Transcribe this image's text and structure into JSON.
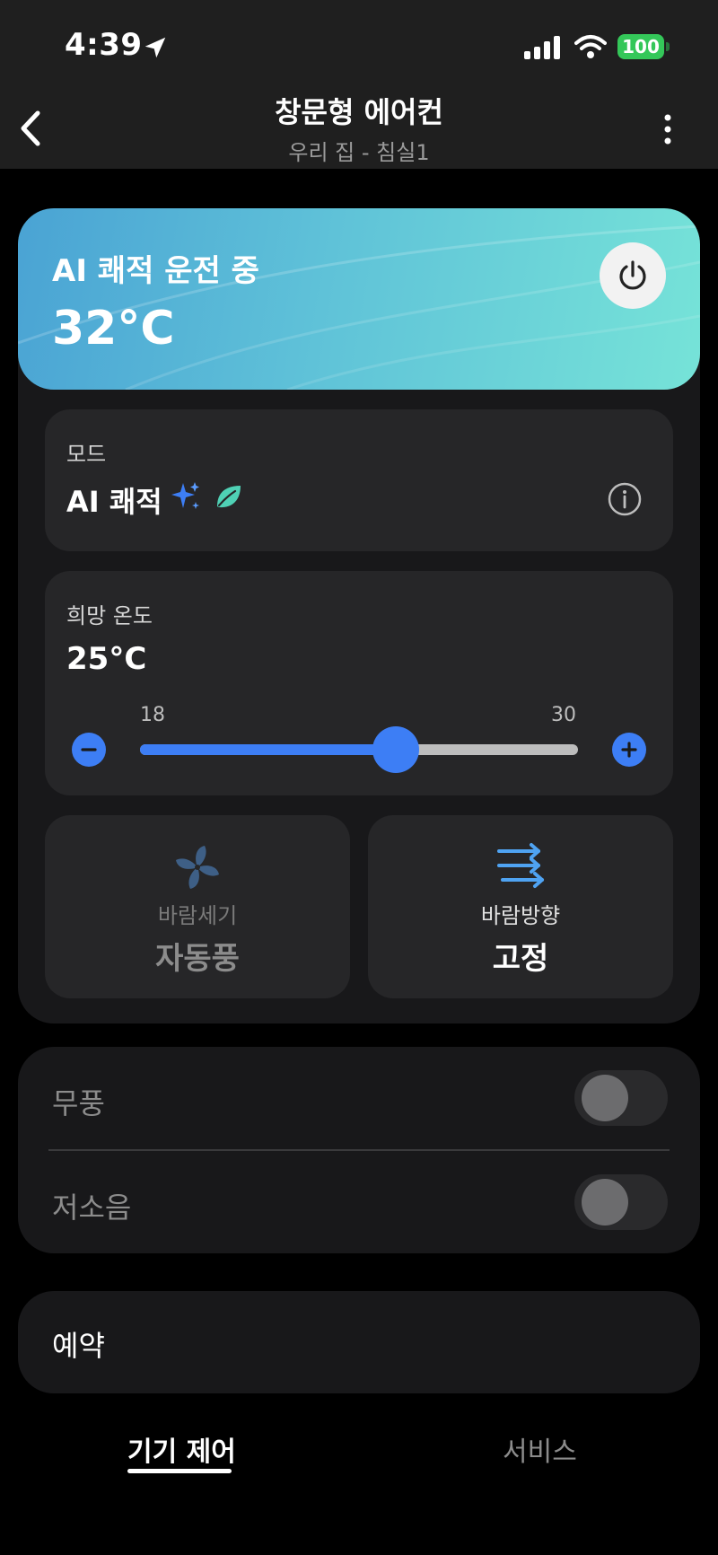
{
  "status_bar": {
    "time": "4:39",
    "battery": "100"
  },
  "header": {
    "title": "창문형 에어컨",
    "subtitle": "우리 집 - 침실1"
  },
  "banner": {
    "status": "AI 쾌적 운전 중",
    "current_temp": "32°C"
  },
  "mode": {
    "label": "모드",
    "value": "AI 쾌적",
    "icons": [
      "sparkle-icon",
      "leaf-icon",
      "info-icon"
    ]
  },
  "target_temp": {
    "label": "희망 온도",
    "value": "25°C",
    "min": "18",
    "max": "30",
    "setpoint": 25
  },
  "wind_speed": {
    "label": "바람세기",
    "value": "자동풍",
    "icon": "fan-icon"
  },
  "wind_direction": {
    "label": "바람방향",
    "value": "고정",
    "icon": "arrows-right-icon"
  },
  "toggles": [
    {
      "label": "무풍",
      "on": false
    },
    {
      "label": "저소음",
      "on": false
    }
  ],
  "reservation": {
    "label": "예약"
  },
  "tabs": [
    {
      "label": "기기 제어",
      "active": true
    },
    {
      "label": "서비스",
      "active": false
    }
  ],
  "colors": {
    "accent": "#3d7ef5",
    "battery": "#34c759",
    "banner_start": "#4aa3d4",
    "banner_end": "#76e3d8"
  }
}
